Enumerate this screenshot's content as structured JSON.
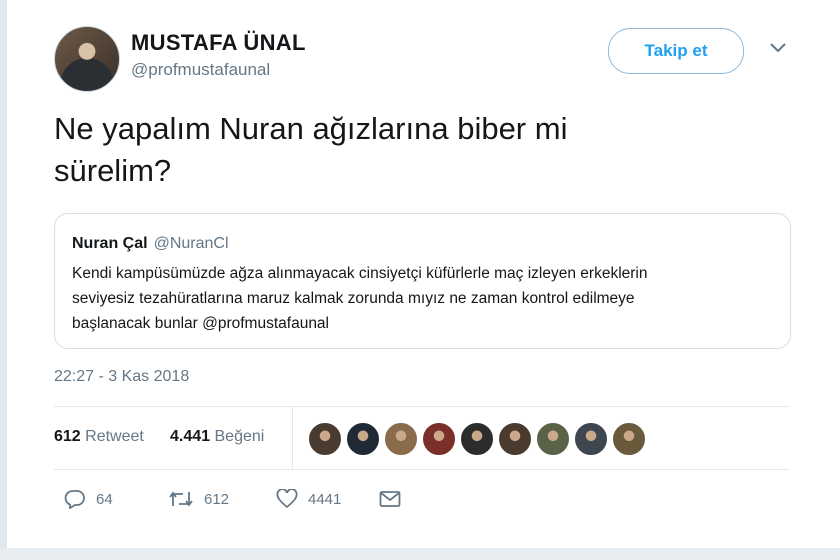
{
  "author": {
    "name": "MUSTAFA ÜNAL",
    "handle": "@profmustafaunal",
    "follow_label": "Takip et"
  },
  "tweet": {
    "text_line1": "Ne yapalım Nuran ağızlarına biber mi",
    "text_line2": "sürelim?"
  },
  "quoted": {
    "name": "Nuran Çal",
    "handle": "@NuranCl",
    "line1": "Kendi kampüsümüzde ağza alınmayacak cinsiyetçi küfürlerle maç izleyen erkeklerin",
    "line2": "seviyesiz tezahüratlarına maruz kalmak zorunda mıyız ne zaman kontrol edilmeye",
    "line3": "başlanacak bunlar  @profmustafaunal"
  },
  "timestamp": "22:27 - 3 Kas 2018",
  "stats": {
    "retweets": "612",
    "retweet_label": "Retweet",
    "likes": "4.441",
    "like_label": "Beğeni"
  },
  "actions": {
    "replies": "64",
    "retweets": "612",
    "likes": "4441"
  },
  "likers": [
    "#4a3b30",
    "#1f2a36",
    "#8a6b4c",
    "#7a2f2a",
    "#2c2c2c",
    "#4b3a2e",
    "#5a6248",
    "#3e4650",
    "#6a5a3c"
  ],
  "colors": {
    "accent": "#1da1f2",
    "muted": "#657786",
    "border": "#e1e8ed"
  },
  "icons": {
    "menu": "chevron-down-icon",
    "reply": "reply-icon",
    "retweet": "retweet-icon",
    "like": "heart-icon",
    "dm": "envelope-icon"
  }
}
